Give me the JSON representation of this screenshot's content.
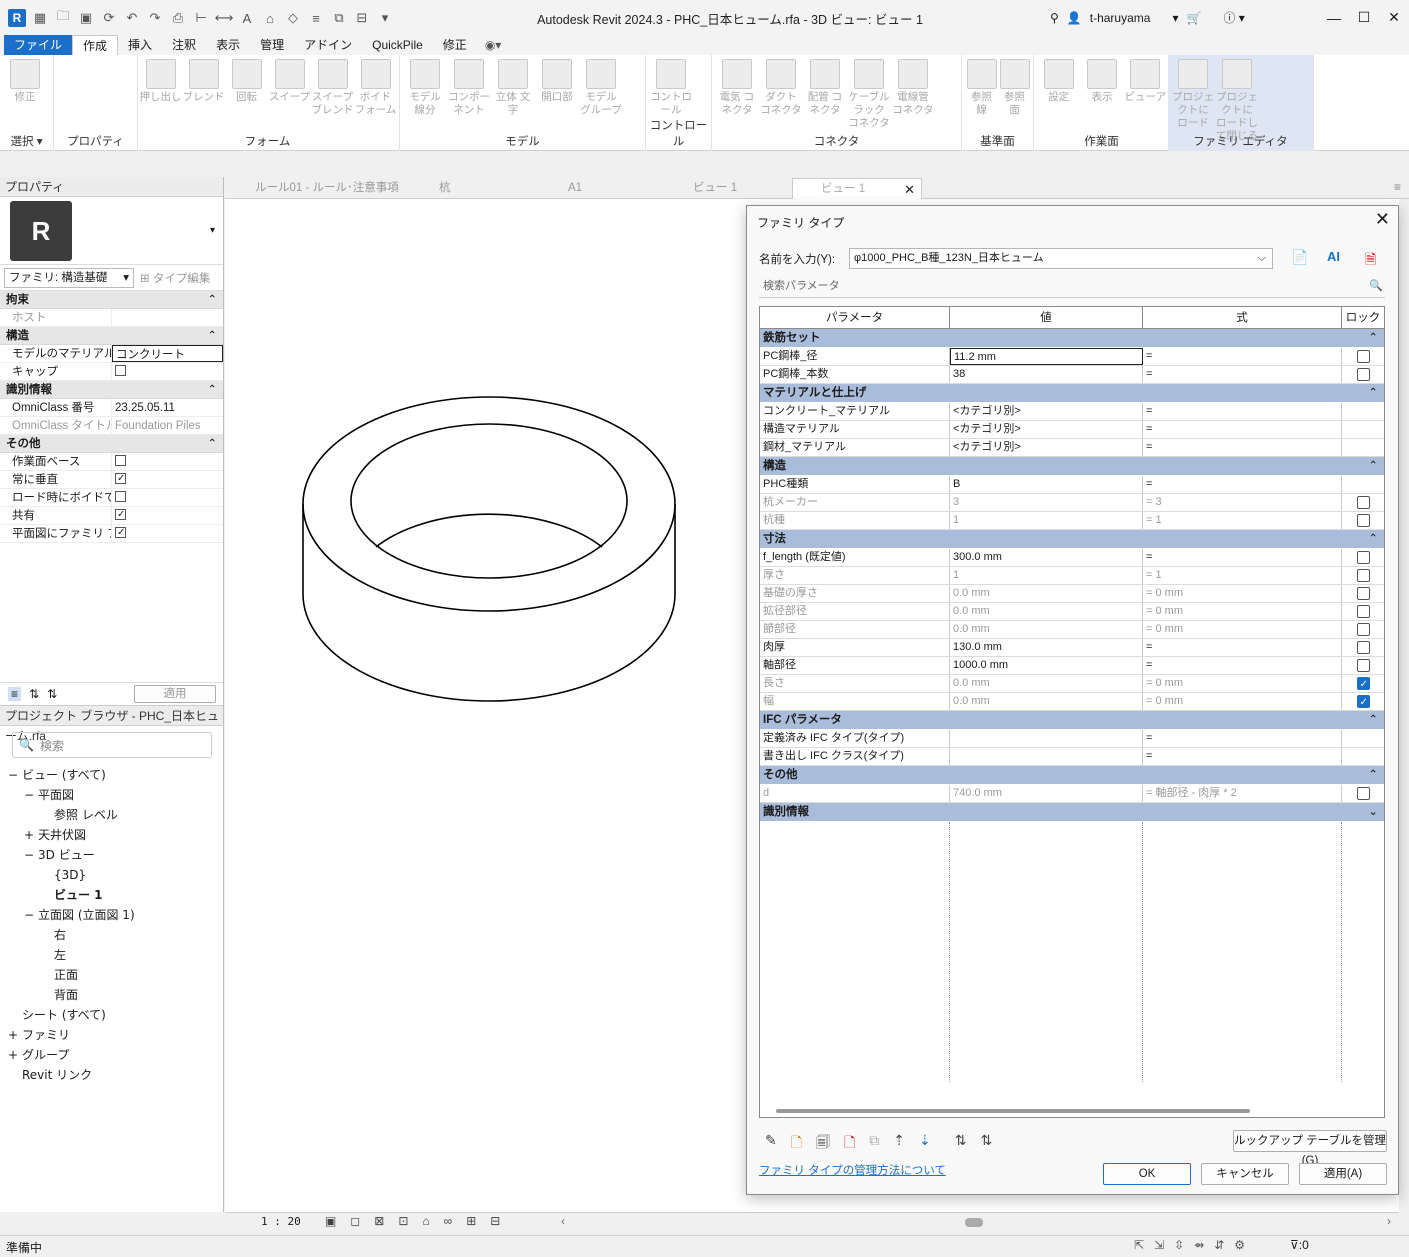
{
  "window": {
    "title": "Autodesk Revit 2024.3 - PHC_日本ヒューム.rfa - 3D ビュー: ビュー 1",
    "user": "t-haruyama"
  },
  "ribbon_tabs": [
    "ファイル",
    "作成",
    "挿入",
    "注釈",
    "表示",
    "管理",
    "アドイン",
    "QuickPile",
    "修正"
  ],
  "ribbon": {
    "groups": [
      {
        "label": "選択 ▾",
        "buttons": [
          {
            "label": "修正"
          }
        ]
      },
      {
        "label": "プロパティ",
        "buttons": []
      },
      {
        "label": "フォーム",
        "buttons": [
          {
            "label": "押し出し"
          },
          {
            "label": "ブレンド"
          },
          {
            "label": "回転"
          },
          {
            "label": "スイープ"
          },
          {
            "label": "スイープ ブレンド"
          },
          {
            "label": "ボイド フォーム"
          }
        ]
      },
      {
        "label": "モデル",
        "buttons": [
          {
            "label": "モデル 線分"
          },
          {
            "label": "コンポーネント"
          },
          {
            "label": "立体 文字"
          },
          {
            "label": "開口部"
          },
          {
            "label": "モデル グループ"
          }
        ]
      },
      {
        "label": "コントロール",
        "buttons": [
          {
            "label": "コントロール"
          }
        ]
      },
      {
        "label": "コネクタ",
        "buttons": [
          {
            "label": "電気 コネクタ"
          },
          {
            "label": "ダクト コネクタ"
          },
          {
            "label": "配管 コネクタ"
          },
          {
            "label": "ケーブル ラック コネクタ"
          },
          {
            "label": "電線管 コネクタ"
          }
        ]
      },
      {
        "label": "基準面",
        "buttons": [
          {
            "label": "参照 線"
          },
          {
            "label": "参照 面"
          }
        ]
      },
      {
        "label": "作業面",
        "buttons": [
          {
            "label": "設定"
          },
          {
            "label": "表示"
          },
          {
            "label": "ビューア"
          }
        ]
      },
      {
        "label": "ファミリ エディタ",
        "buttons": [
          {
            "label": "プロジェクトに ロード"
          },
          {
            "label": "プロジェクトに ロードして閉じる"
          }
        ]
      }
    ]
  },
  "properties": {
    "header": "プロパティ",
    "family_selector": "ファミリ: 構造基礎",
    "type_edit": "タイプ編集",
    "apply": "適用",
    "sections": [
      {
        "title": "拘束",
        "rows": [
          {
            "k": "ホスト",
            "v": "",
            "dis": true
          }
        ]
      },
      {
        "title": "構造",
        "rows": [
          {
            "k": "モデルのマテリアル...",
            "v": "コンクリート",
            "input": true
          },
          {
            "k": "キャップ",
            "cb": false
          }
        ]
      },
      {
        "title": "識別情報",
        "rows": [
          {
            "k": "OmniClass 番号",
            "v": "23.25.05.11"
          },
          {
            "k": "OmniClass タイトル",
            "v": "Foundation Piles",
            "dis": true
          }
        ]
      },
      {
        "title": "その他",
        "rows": [
          {
            "k": "作業面ベース",
            "cb": false
          },
          {
            "k": "常に垂直",
            "cb": true
          },
          {
            "k": "ロード時にボイドで...",
            "cb": false
          },
          {
            "k": "共有",
            "cb": true
          },
          {
            "k": "平面図にファミリ プ...",
            "cb": true
          }
        ]
      }
    ]
  },
  "browser": {
    "header": "プロジェクト ブラウザ - PHC_日本ヒューム.rfa",
    "search_placeholder": "検索",
    "tree": [
      {
        "t": "ビュー (すべて)",
        "lvl": 0,
        "exp": "−"
      },
      {
        "t": "平面図",
        "lvl": 1,
        "exp": "−"
      },
      {
        "t": "参照 レベル",
        "lvl": 2
      },
      {
        "t": "天井伏図",
        "lvl": 1,
        "exp": "+"
      },
      {
        "t": "3D ビュー",
        "lvl": 1,
        "exp": "−"
      },
      {
        "t": "{3D}",
        "lvl": 2
      },
      {
        "t": "ビュー 1",
        "lvl": 2,
        "bold": true
      },
      {
        "t": "立面図 (立面図 1)",
        "lvl": 1,
        "exp": "−"
      },
      {
        "t": "右",
        "lvl": 2
      },
      {
        "t": "左",
        "lvl": 2
      },
      {
        "t": "正面",
        "lvl": 2
      },
      {
        "t": "背面",
        "lvl": 2
      },
      {
        "t": "シート (すべて)",
        "lvl": 0
      },
      {
        "t": "ファミリ",
        "lvl": 0,
        "exp": "+"
      },
      {
        "t": "グループ",
        "lvl": 0,
        "exp": "+"
      },
      {
        "t": "Revit リンク",
        "lvl": 0
      }
    ]
  },
  "view_tabs": [
    "ルール01 - ルール･注意事項",
    "杭",
    "A1",
    "ビュー 1",
    "ビュー 1"
  ],
  "view_scale": "1 : 20",
  "status": {
    "left": "準備中",
    "filter_count": ":0"
  },
  "dialog": {
    "title": "ファミリ タイプ",
    "name_label": "名前を入力(Y):",
    "type_name": "φ1000_PHC_B種_123N_日本ヒューム",
    "search_placeholder": "検索パラメータ",
    "headers": [
      "パラメータ",
      "値",
      "式",
      "ロック"
    ],
    "sections": [
      {
        "title": "鉄筋セット",
        "rows": [
          {
            "p": "PC鋼棒_径",
            "v": "11.2 mm",
            "f": "=",
            "lock": false,
            "sel": true
          },
          {
            "p": "PC鋼棒_本数",
            "v": "38",
            "f": "=",
            "lock": false
          }
        ]
      },
      {
        "title": "マテリアルと仕上げ",
        "rows": [
          {
            "p": "コンクリート_マテリアル",
            "v": "<カテゴリ別>",
            "f": "="
          },
          {
            "p": "構造マテリアル",
            "v": "<カテゴリ別>",
            "f": "="
          },
          {
            "p": "鋼材_マテリアル",
            "v": "<カテゴリ別>",
            "f": "="
          }
        ]
      },
      {
        "title": "構造",
        "rows": [
          {
            "p": "PHC種類",
            "v": "B",
            "f": "="
          },
          {
            "p": "杭メーカー",
            "v": "3",
            "f": "= 3",
            "lock": false,
            "dis": true
          },
          {
            "p": "杭種",
            "v": "1",
            "f": "= 1",
            "lock": false,
            "dis": true
          }
        ]
      },
      {
        "title": "寸法",
        "rows": [
          {
            "p": "f_length (既定値)",
            "v": "300.0 mm",
            "f": "=",
            "lock": false
          },
          {
            "p": "厚さ",
            "v": "1",
            "f": "= 1",
            "lock": false,
            "dis": true
          },
          {
            "p": "基礎の厚さ",
            "v": "0.0 mm",
            "f": "= 0 mm",
            "lock": false,
            "dis": true
          },
          {
            "p": "拡径部径",
            "v": "0.0 mm",
            "f": "= 0 mm",
            "lock": false,
            "dis": true
          },
          {
            "p": "節部径",
            "v": "0.0 mm",
            "f": "= 0 mm",
            "lock": false,
            "dis": true
          },
          {
            "p": "肉厚",
            "v": "130.0 mm",
            "f": "=",
            "lock": false
          },
          {
            "p": "軸部径",
            "v": "1000.0 mm",
            "f": "=",
            "lock": false
          },
          {
            "p": "長さ",
            "v": "0.0 mm",
            "f": "= 0 mm",
            "lock": true,
            "dis": true
          },
          {
            "p": "幅",
            "v": "0.0 mm",
            "f": "= 0 mm",
            "lock": true,
            "dis": true
          }
        ]
      },
      {
        "title": "IFC パラメータ",
        "rows": [
          {
            "p": "定義済み IFC タイプ(タイプ)",
            "v": "",
            "f": "="
          },
          {
            "p": "書き出し IFC クラス(タイプ)",
            "v": "",
            "f": "="
          }
        ]
      },
      {
        "title": "その他",
        "rows": [
          {
            "p": "d",
            "v": "740.0 mm",
            "f": "= 軸部径 - 肉厚 * 2",
            "lock": false,
            "dis": true
          }
        ]
      },
      {
        "title": "識別情報",
        "rows": [],
        "collapsed": true
      }
    ],
    "lookup_button": "ルックアップ テーブルを管理(G)",
    "help_link": "ファミリ タイプの管理方法について",
    "ok": "OK",
    "cancel": "キャンセル",
    "apply": "適用(A)"
  }
}
